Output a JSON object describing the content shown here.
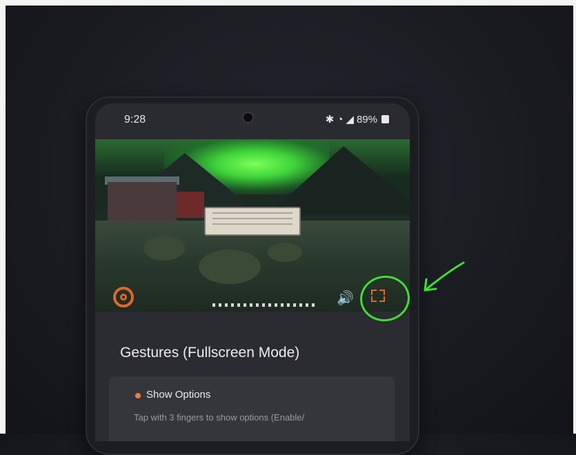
{
  "status_bar": {
    "time": "9:28",
    "battery_percent": "89%",
    "icons": [
      "bluetooth-icon",
      "wifi-icon",
      "signal-icon",
      "battery-icon"
    ]
  },
  "video": {
    "controls": [
      "app-logo-icon",
      "volume-icon",
      "fullscreen-icon"
    ],
    "accent_color": "#e4662a"
  },
  "settings": {
    "section_title": "Gestures (Fullscreen Mode)",
    "option_title": "Show Options",
    "option_description": "Tap with 3 fingers to show options (Enable/"
  },
  "annotation": {
    "color": "#3ee032",
    "target": "fullscreen-icon"
  }
}
